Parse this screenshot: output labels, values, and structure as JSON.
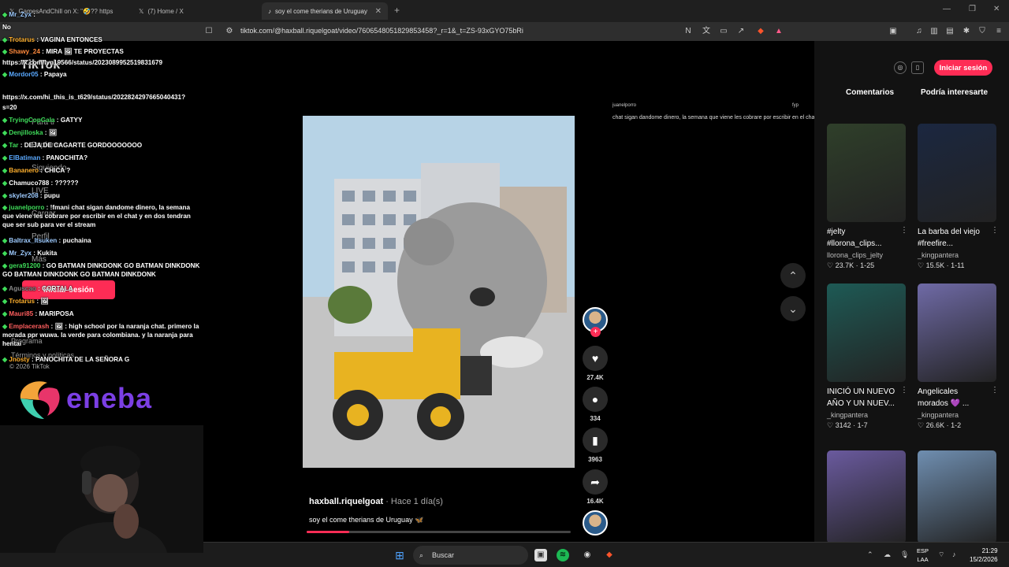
{
  "browser": {
    "tabs": [
      {
        "label": "GamesAndChill on X: \"🤣?? https",
        "active": false
      },
      {
        "label": "(7) Home / X",
        "active": false
      },
      {
        "label": "soy el come therians de Uruguay",
        "active": true
      }
    ],
    "new_tab": "+",
    "url": "tiktok.com/@haxball.riquelgoat/video/7606548051829853458?_r=1&_t=ZS-93xGYO75bRi"
  },
  "chat": [
    {
      "user": "Mr_Zyx",
      "color": "#9ecbff",
      "text": ""
    },
    {
      "user": "",
      "color": "#ff3b3b",
      "text": "No"
    },
    {
      "user": "Trotarus",
      "color": "#ffb02e",
      "text": "VAGINA ENTONCES"
    },
    {
      "user": "Shawy_24",
      "color": "#ff8a3d",
      "text": "MIRA 🖼 TE PROYECTAS"
    },
    {
      "user": "",
      "color": "#fff",
      "text": "https://x.com/lyn19566/status/2023089952519831679"
    },
    {
      "user": "Mordor05",
      "color": "#5aa9ff",
      "text": "Papaya"
    },
    {
      "user": "",
      "color": "#fff",
      "text": "https://x.com/hi_this_is_t629/status/2022824297665040431?"
    },
    {
      "user": "",
      "color": "#fff",
      "text": "s=20"
    },
    {
      "user": "TryingCopGala",
      "color": "#3fdc5a",
      "text": "GATYY"
    },
    {
      "user": "Denjilloska",
      "color": "#3fdc5a",
      "text": "🖼"
    },
    {
      "user": "Tar",
      "color": "#3fdc5a",
      "text": "DEJA DE CAGARTE GORDOOOOOOO"
    },
    {
      "user": "ElBatiman",
      "color": "#5aa9ff",
      "text": "PANOCHITA?"
    },
    {
      "user": "Bananero",
      "color": "#ffb02e",
      "text": "CHICA ?"
    },
    {
      "user": "Chamuco788",
      "color": "#fff",
      "text": "??????"
    },
    {
      "user": "skyler208",
      "color": "#9ecbff",
      "text": "pupu"
    },
    {
      "user": "juanelporro",
      "color": "#3fdc5a",
      "text": "!fmani chat sigan dandome dinero, la semana que viene les cobrare por escribir en el chat y en dos tendran que ser sub para ver el stream"
    },
    {
      "user": "Baltrax_Itsuken",
      "color": "#9ecbff",
      "text": "puchaina"
    },
    {
      "user": "Mr_Zyx",
      "color": "#9ecbff",
      "text": "Kukita"
    },
    {
      "user": "gera91200",
      "color": "#3fdc5a",
      "text": "GO BATMAN DINKDONK GO BATMAN DINKDONK GO BATMAN DINKDONK GO BATMAN DINKDONK"
    },
    {
      "user": "Aguscao",
      "color": "#888",
      "text": "CORTALA"
    },
    {
      "user": "Trotarus",
      "color": "#ffb02e",
      "text": "🖼"
    },
    {
      "user": "Mauri85",
      "color": "#ff5e5e",
      "text": "MARIPOSA"
    },
    {
      "user": "Emplacerash",
      "color": "#ff5e5e",
      "text": "🖼 : high school por la naranja chat. primero la morada ppr wuwa. la verde para colombiana. y la naranja para hentai"
    },
    {
      "user": "Jnosty",
      "color": "#ffb02e",
      "text": "PANOCHITA DE LA SEÑORA G"
    }
  ],
  "tiktok_sidebar": {
    "logo": "TikTok",
    "nav": [
      "Para ti",
      "Explorar",
      "Siguiendo",
      "LIVE",
      "Cargar",
      "Perfil",
      "Más"
    ],
    "login": "Iniciar sesión",
    "footer_links": [
      "Programa",
      "Términos y políticas"
    ],
    "copyright": "© 2026 TikTok"
  },
  "eneba": {
    "text": "eneba",
    "brand_color": "#7b3fe4"
  },
  "video": {
    "overlay_user": "juanelporro",
    "overlay_tag": "fyp",
    "overlay_caption": "chat sigan dandome dinero, la semana que viene les cobrare por escribir en el chat y en dos tendran que ser sub para ver el stream",
    "author": "haxball.riquelgoat",
    "time": " · Hace 1 día(s)",
    "description": "soy el come therians de Uruguay 🦋",
    "progress": 0.16
  },
  "actions": {
    "likes": "27.4K",
    "comments": "334",
    "saves": "3963",
    "shares": "16.4K"
  },
  "right_panel": {
    "tab_comments": "Comentarios",
    "tab_interesting": "Podría interesarte",
    "login_button": "Iniciar sesión",
    "cards": [
      {
        "title1": "#jelty",
        "title2": "#llorona_clips...",
        "author": "llorona_clips_jelty",
        "likes": "23.7K",
        "date": "1-25",
        "color": "#2f3f2a"
      },
      {
        "title1": "La barba del viejo",
        "title2": "#freefire...",
        "author": "_kingpantera",
        "likes": "15.5K",
        "date": "1-11",
        "color": "#1b2740"
      },
      {
        "title1": "INICIÓ UN NUEVO",
        "title2": "AÑO Y UN NUEV...",
        "author": "_kingpantera",
        "likes": "3142",
        "date": "1-7",
        "color": "#1e5a55"
      },
      {
        "title1": "Angelicales",
        "title2": "morados 💜 ...",
        "author": "_kingpantera",
        "likes": "26.6K",
        "date": "1-2",
        "color": "#6f6aa6"
      },
      {
        "title1": "",
        "title2": "",
        "author": "",
        "likes": "",
        "date": "",
        "color": "#6a5a9e"
      },
      {
        "title1": "",
        "title2": "",
        "author": "",
        "likes": "",
        "date": "",
        "color": "#6f8eb0"
      }
    ]
  },
  "taskbar": {
    "search": "Buscar",
    "lang1": "ESP",
    "lang2": "LAA",
    "time": "21:29",
    "date": "15/2/2026"
  }
}
